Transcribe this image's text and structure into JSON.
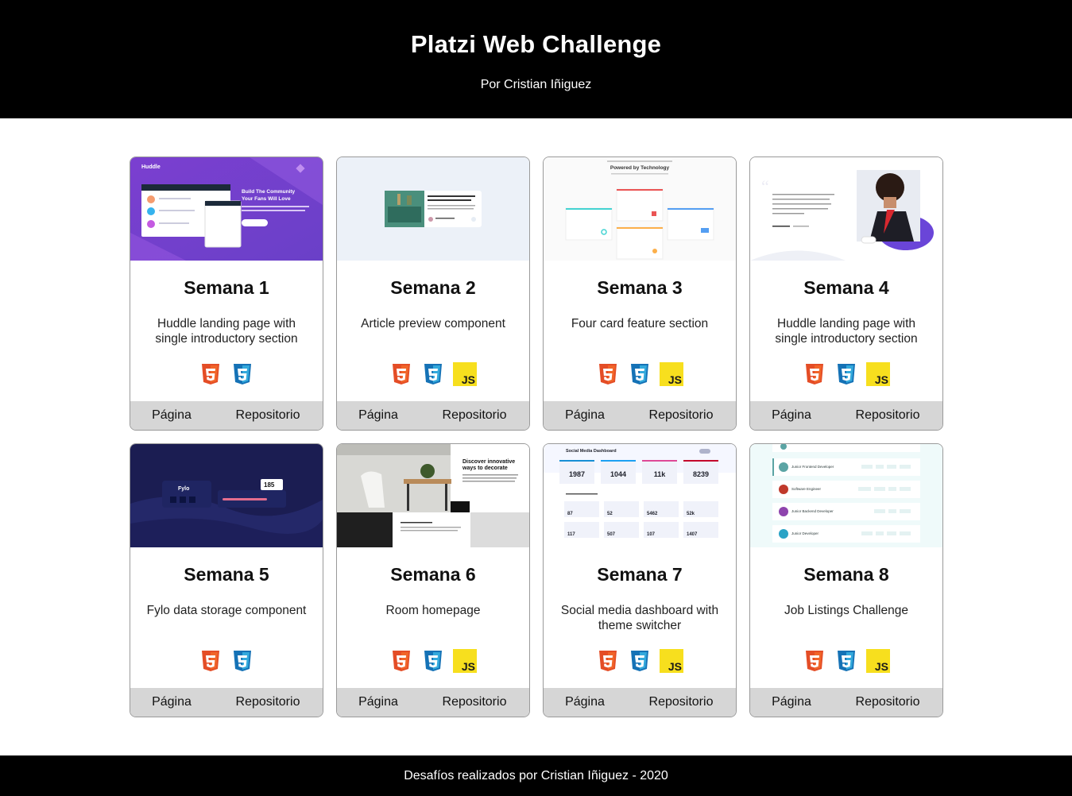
{
  "header": {
    "title": "Platzi Web Challenge",
    "subtitle": "Por Cristian Iñiguez"
  },
  "cards": [
    {
      "title": "Semana 1",
      "desc": "Huddle landing page with single introductory section",
      "techs": [
        "html5-icon",
        "css3-icon"
      ],
      "page_label": "Página",
      "repo_label": "Repositorio",
      "thumb_text": [
        "Huddle",
        "Build The Community",
        "Your Fans Will Love"
      ]
    },
    {
      "title": "Semana 2",
      "desc": "Article preview component",
      "techs": [
        "html5-icon",
        "css3-icon",
        "js-icon"
      ],
      "page_label": "Página",
      "repo_label": "Repositorio"
    },
    {
      "title": "Semana 3",
      "desc": "Four card feature section",
      "techs": [
        "html5-icon",
        "css3-icon",
        "js-icon"
      ],
      "page_label": "Página",
      "repo_label": "Repositorio",
      "thumb_text": [
        "Powered by Technology"
      ]
    },
    {
      "title": "Semana 4",
      "desc": "Huddle landing page with single introductory section",
      "techs": [
        "html5-icon",
        "css3-icon",
        "js-icon"
      ],
      "page_label": "Página",
      "repo_label": "Repositorio"
    },
    {
      "title": "Semana 5",
      "desc": "Fylo data storage component",
      "techs": [
        "html5-icon",
        "css3-icon"
      ],
      "page_label": "Página",
      "repo_label": "Repositorio",
      "thumb_text": [
        "Fylo",
        "185"
      ]
    },
    {
      "title": "Semana 6",
      "desc": "Room homepage",
      "techs": [
        "html5-icon",
        "css3-icon",
        "js-icon"
      ],
      "page_label": "Página",
      "repo_label": "Repositorio",
      "thumb_text": [
        "Discover innovative",
        "ways to decorate"
      ]
    },
    {
      "title": "Semana 7",
      "desc": "Social media dashboard with theme switcher",
      "techs": [
        "html5-icon",
        "css3-icon",
        "js-icon"
      ],
      "page_label": "Página",
      "repo_label": "Repositorio",
      "thumb_text": [
        "Social Media Dashboard",
        "1987",
        "1044",
        "11k",
        "8239",
        "87",
        "52",
        "5462",
        "52k",
        "117",
        "507",
        "107",
        "1407"
      ]
    },
    {
      "title": "Semana 8",
      "desc": "Job Listings Challenge",
      "techs": [
        "html5-icon",
        "css3-icon",
        "js-icon"
      ],
      "page_label": "Página",
      "repo_label": "Repositorio",
      "thumb_text": [
        "Junior Frontend Developer",
        "Software Engineer",
        "Junior Backend Developer",
        "Junior Developer"
      ]
    }
  ],
  "footer": {
    "text": "Desafíos realizados por Cristian Iñiguez - 2020"
  },
  "colors": {
    "html5": "#e44d26",
    "css3": "#1572b6",
    "js": "#f7df1e",
    "link_bar": "#d6d6d6",
    "header_bg": "#000000"
  }
}
